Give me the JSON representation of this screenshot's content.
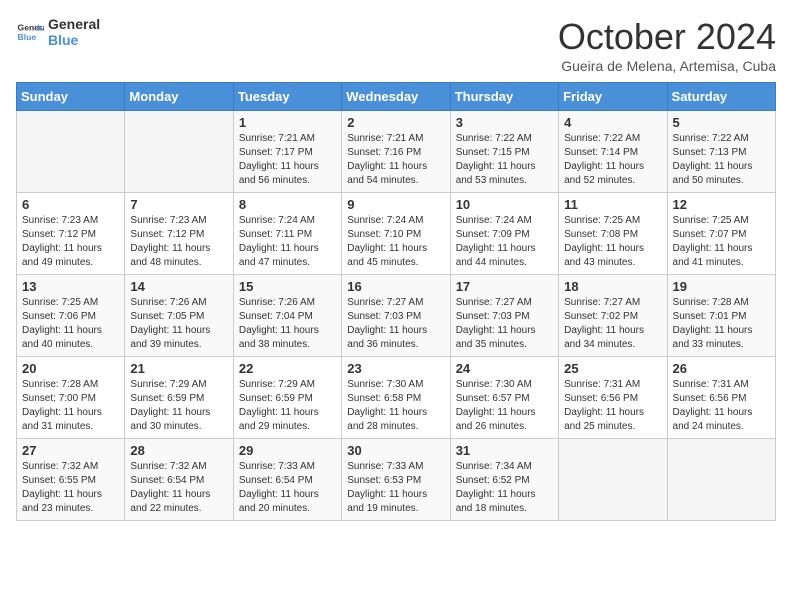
{
  "header": {
    "logo_line1": "General",
    "logo_line2": "Blue",
    "month": "October 2024",
    "location": "Gueira de Melena, Artemisa, Cuba"
  },
  "days_of_week": [
    "Sunday",
    "Monday",
    "Tuesday",
    "Wednesday",
    "Thursday",
    "Friday",
    "Saturday"
  ],
  "weeks": [
    [
      {
        "day": "",
        "sunrise": "",
        "sunset": "",
        "daylight": ""
      },
      {
        "day": "",
        "sunrise": "",
        "sunset": "",
        "daylight": ""
      },
      {
        "day": "1",
        "sunrise": "Sunrise: 7:21 AM",
        "sunset": "Sunset: 7:17 PM",
        "daylight": "Daylight: 11 hours and 56 minutes."
      },
      {
        "day": "2",
        "sunrise": "Sunrise: 7:21 AM",
        "sunset": "Sunset: 7:16 PM",
        "daylight": "Daylight: 11 hours and 54 minutes."
      },
      {
        "day": "3",
        "sunrise": "Sunrise: 7:22 AM",
        "sunset": "Sunset: 7:15 PM",
        "daylight": "Daylight: 11 hours and 53 minutes."
      },
      {
        "day": "4",
        "sunrise": "Sunrise: 7:22 AM",
        "sunset": "Sunset: 7:14 PM",
        "daylight": "Daylight: 11 hours and 52 minutes."
      },
      {
        "day": "5",
        "sunrise": "Sunrise: 7:22 AM",
        "sunset": "Sunset: 7:13 PM",
        "daylight": "Daylight: 11 hours and 50 minutes."
      }
    ],
    [
      {
        "day": "6",
        "sunrise": "Sunrise: 7:23 AM",
        "sunset": "Sunset: 7:12 PM",
        "daylight": "Daylight: 11 hours and 49 minutes."
      },
      {
        "day": "7",
        "sunrise": "Sunrise: 7:23 AM",
        "sunset": "Sunset: 7:12 PM",
        "daylight": "Daylight: 11 hours and 48 minutes."
      },
      {
        "day": "8",
        "sunrise": "Sunrise: 7:24 AM",
        "sunset": "Sunset: 7:11 PM",
        "daylight": "Daylight: 11 hours and 47 minutes."
      },
      {
        "day": "9",
        "sunrise": "Sunrise: 7:24 AM",
        "sunset": "Sunset: 7:10 PM",
        "daylight": "Daylight: 11 hours and 45 minutes."
      },
      {
        "day": "10",
        "sunrise": "Sunrise: 7:24 AM",
        "sunset": "Sunset: 7:09 PM",
        "daylight": "Daylight: 11 hours and 44 minutes."
      },
      {
        "day": "11",
        "sunrise": "Sunrise: 7:25 AM",
        "sunset": "Sunset: 7:08 PM",
        "daylight": "Daylight: 11 hours and 43 minutes."
      },
      {
        "day": "12",
        "sunrise": "Sunrise: 7:25 AM",
        "sunset": "Sunset: 7:07 PM",
        "daylight": "Daylight: 11 hours and 41 minutes."
      }
    ],
    [
      {
        "day": "13",
        "sunrise": "Sunrise: 7:25 AM",
        "sunset": "Sunset: 7:06 PM",
        "daylight": "Daylight: 11 hours and 40 minutes."
      },
      {
        "day": "14",
        "sunrise": "Sunrise: 7:26 AM",
        "sunset": "Sunset: 7:05 PM",
        "daylight": "Daylight: 11 hours and 39 minutes."
      },
      {
        "day": "15",
        "sunrise": "Sunrise: 7:26 AM",
        "sunset": "Sunset: 7:04 PM",
        "daylight": "Daylight: 11 hours and 38 minutes."
      },
      {
        "day": "16",
        "sunrise": "Sunrise: 7:27 AM",
        "sunset": "Sunset: 7:03 PM",
        "daylight": "Daylight: 11 hours and 36 minutes."
      },
      {
        "day": "17",
        "sunrise": "Sunrise: 7:27 AM",
        "sunset": "Sunset: 7:03 PM",
        "daylight": "Daylight: 11 hours and 35 minutes."
      },
      {
        "day": "18",
        "sunrise": "Sunrise: 7:27 AM",
        "sunset": "Sunset: 7:02 PM",
        "daylight": "Daylight: 11 hours and 34 minutes."
      },
      {
        "day": "19",
        "sunrise": "Sunrise: 7:28 AM",
        "sunset": "Sunset: 7:01 PM",
        "daylight": "Daylight: 11 hours and 33 minutes."
      }
    ],
    [
      {
        "day": "20",
        "sunrise": "Sunrise: 7:28 AM",
        "sunset": "Sunset: 7:00 PM",
        "daylight": "Daylight: 11 hours and 31 minutes."
      },
      {
        "day": "21",
        "sunrise": "Sunrise: 7:29 AM",
        "sunset": "Sunset: 6:59 PM",
        "daylight": "Daylight: 11 hours and 30 minutes."
      },
      {
        "day": "22",
        "sunrise": "Sunrise: 7:29 AM",
        "sunset": "Sunset: 6:59 PM",
        "daylight": "Daylight: 11 hours and 29 minutes."
      },
      {
        "day": "23",
        "sunrise": "Sunrise: 7:30 AM",
        "sunset": "Sunset: 6:58 PM",
        "daylight": "Daylight: 11 hours and 28 minutes."
      },
      {
        "day": "24",
        "sunrise": "Sunrise: 7:30 AM",
        "sunset": "Sunset: 6:57 PM",
        "daylight": "Daylight: 11 hours and 26 minutes."
      },
      {
        "day": "25",
        "sunrise": "Sunrise: 7:31 AM",
        "sunset": "Sunset: 6:56 PM",
        "daylight": "Daylight: 11 hours and 25 minutes."
      },
      {
        "day": "26",
        "sunrise": "Sunrise: 7:31 AM",
        "sunset": "Sunset: 6:56 PM",
        "daylight": "Daylight: 11 hours and 24 minutes."
      }
    ],
    [
      {
        "day": "27",
        "sunrise": "Sunrise: 7:32 AM",
        "sunset": "Sunset: 6:55 PM",
        "daylight": "Daylight: 11 hours and 23 minutes."
      },
      {
        "day": "28",
        "sunrise": "Sunrise: 7:32 AM",
        "sunset": "Sunset: 6:54 PM",
        "daylight": "Daylight: 11 hours and 22 minutes."
      },
      {
        "day": "29",
        "sunrise": "Sunrise: 7:33 AM",
        "sunset": "Sunset: 6:54 PM",
        "daylight": "Daylight: 11 hours and 20 minutes."
      },
      {
        "day": "30",
        "sunrise": "Sunrise: 7:33 AM",
        "sunset": "Sunset: 6:53 PM",
        "daylight": "Daylight: 11 hours and 19 minutes."
      },
      {
        "day": "31",
        "sunrise": "Sunrise: 7:34 AM",
        "sunset": "Sunset: 6:52 PM",
        "daylight": "Daylight: 11 hours and 18 minutes."
      },
      {
        "day": "",
        "sunrise": "",
        "sunset": "",
        "daylight": ""
      },
      {
        "day": "",
        "sunrise": "",
        "sunset": "",
        "daylight": ""
      }
    ]
  ]
}
